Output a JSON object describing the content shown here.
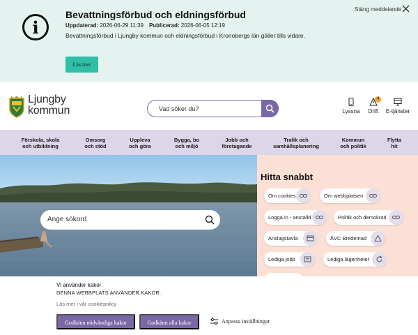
{
  "alert": {
    "title": "Bevattningsförbud och eldningsförbud",
    "updated_label": "Uppdaterad:",
    "updated_value": "2026-06-29 11:39",
    "published_label": "Publicerad:",
    "published_value": "2026-06-05 12:19",
    "text": "Bevattningsförbud i Ljungby kommun och eldningsförbud i Kronobergs län gäller tills vidare.",
    "read_more": "Läs mer",
    "close_label": "Stäng meddelande",
    "icon": "info-icon"
  },
  "header": {
    "logo_line1": "Ljungby",
    "logo_line2": "kommun",
    "search_placeholder": "Vad söker du?",
    "tools": [
      {
        "label": "Lyssna",
        "icon": "phone-icon"
      },
      {
        "label": "Drift",
        "icon": "warning-icon",
        "badge": "4"
      },
      {
        "label": "E-tjänster",
        "icon": "monitor-icon"
      }
    ]
  },
  "nav": {
    "items": [
      {
        "line1": "Förskola, skola",
        "line2": "och utbildning"
      },
      {
        "line1": "Omsorg",
        "line2": "och stöd"
      },
      {
        "line1": "Uppleva",
        "line2": "och göra"
      },
      {
        "line1": "Bygga, bo",
        "line2": "och miljö"
      },
      {
        "line1": "Jobb och",
        "line2": "företagande"
      },
      {
        "line1": "Trafik och",
        "line2": "samhällsplanering"
      },
      {
        "line1": "Kommun",
        "line2": "och politik"
      },
      {
        "line1": "Flytta",
        "line2": "hit"
      }
    ]
  },
  "hero": {
    "search_placeholder": "Ange sökord"
  },
  "quick": {
    "title": "Hitta snabbt",
    "links": [
      {
        "label": "Om cookies",
        "icon": "link-icon"
      },
      {
        "label": "Om webbplatsen",
        "icon": "link-icon"
      },
      {
        "label": "Logga in - anställd",
        "icon": "link-icon"
      },
      {
        "label": "Politik och demokrati",
        "icon": "link-icon"
      },
      {
        "label": "Anslagstavla",
        "icon": "board-icon"
      },
      {
        "label": "ÅVC Bredemad",
        "icon": "recycle-icon"
      },
      {
        "label": "Lediga jobb",
        "icon": "list-icon"
      },
      {
        "label": "Lediga lägenheter",
        "icon": "refresh-icon"
      }
    ]
  },
  "cookie": {
    "title": "Vi använder kakor",
    "subtitle": "DENNA WEBBPLATS ANVÄNDER KAKOR.",
    "link": "Läs mer i vår cookiepolicy",
    "accept_necessary": "Godkänn nödvändiga kakor",
    "accept_all": "Godkänn alla kakor",
    "settings": "Anpassa inställningar"
  },
  "colors": {
    "alert_bg": "#e4f3ef",
    "alert_button": "#2fbfa6",
    "brand_purple": "#7a68a6",
    "nav_bg": "#ddd5e8",
    "quick_bg": "#fde0d5",
    "badge": "#f5a623"
  }
}
